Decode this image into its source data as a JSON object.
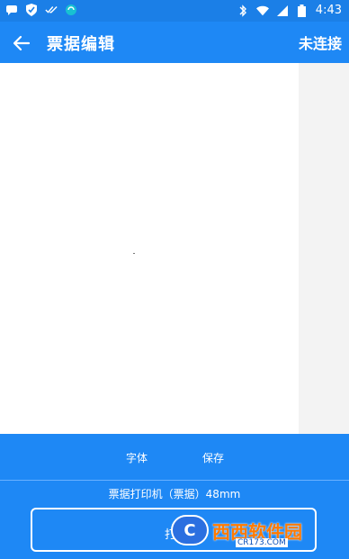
{
  "status": {
    "time": "4:43",
    "battery_icon": "battery-icon",
    "signal_icon": "signal-icon",
    "wifi_icon": "wifi-icon"
  },
  "header": {
    "title": "票据编辑",
    "connection_status": "未连接"
  },
  "toolbar": {
    "font_label": "字体",
    "save_label": "保存"
  },
  "printer": {
    "label": "票据打印机（票据）48mm",
    "print_button_label": "打"
  },
  "watermark": {
    "text": "西西软件园",
    "sub": "CR173.COM"
  },
  "colors": {
    "primary": "#1e88f5",
    "statusbar": "#1b7fe7"
  }
}
